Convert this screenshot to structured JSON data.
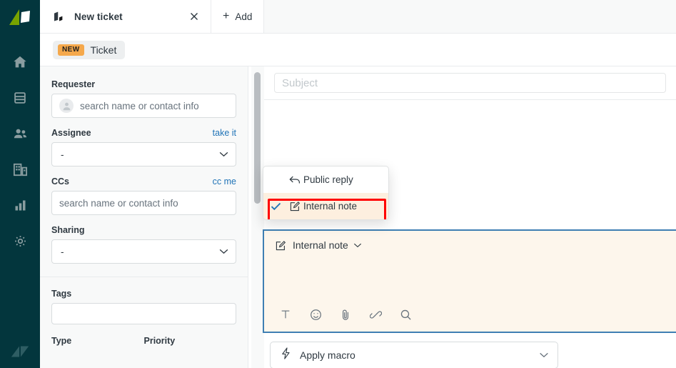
{
  "nav": {
    "logo_icon": "zendesk-logo-icon",
    "items": [
      {
        "name": "home",
        "icon": "home-icon"
      },
      {
        "name": "views",
        "icon": "views-list-icon"
      },
      {
        "name": "customers",
        "icon": "people-icon"
      },
      {
        "name": "organizations",
        "icon": "buildings-icon"
      },
      {
        "name": "reporting",
        "icon": "bar-chart-icon"
      },
      {
        "name": "admin",
        "icon": "gear-icon"
      }
    ],
    "bottom_logo_icon": "zendesk-z-icon"
  },
  "tabbar": {
    "tab_label": "New ticket",
    "tab_icon": "ticket-icon",
    "close_icon": "close-icon",
    "add_label": "Add",
    "add_plus": "+"
  },
  "ticket_header": {
    "badge": "NEW",
    "title": "Ticket"
  },
  "form": {
    "requester": {
      "label": "Requester",
      "placeholder": "search name or contact info",
      "avatar_icon": "user-avatar-icon"
    },
    "assignee": {
      "label": "Assignee",
      "action": "take it",
      "value": "-"
    },
    "ccs": {
      "label": "CCs",
      "action": "cc me",
      "placeholder": "search name or contact info"
    },
    "sharing": {
      "label": "Sharing",
      "value": "-"
    },
    "tags": {
      "label": "Tags",
      "value": ""
    },
    "type": {
      "label": "Type"
    },
    "priority": {
      "label": "Priority"
    }
  },
  "main": {
    "subject_placeholder": "Subject"
  },
  "channel_menu": {
    "items": [
      {
        "label": "Public reply",
        "icon": "reply-arrow-icon",
        "selected": false
      },
      {
        "label": "Internal note",
        "icon": "note-pencil-icon",
        "selected": true
      }
    ],
    "check_icon": "check-icon",
    "highlight_color": "#ff0000"
  },
  "composer": {
    "channel_label": "Internal note",
    "channel_icon": "note-pencil-icon",
    "chevron_icon": "chevron-down-icon",
    "background_color": "#fdf6ec",
    "border_color": "#3f7fb3",
    "tools": [
      {
        "name": "text-format",
        "icon": "text-format-icon"
      },
      {
        "name": "emoji",
        "icon": "emoji-icon"
      },
      {
        "name": "attachment",
        "icon": "paperclip-icon"
      },
      {
        "name": "link",
        "icon": "link-icon"
      },
      {
        "name": "search",
        "icon": "search-icon"
      }
    ]
  },
  "macro": {
    "label": "Apply macro",
    "icon": "lightning-bolt-icon",
    "chevron_icon": "chevron-down-icon"
  },
  "colors": {
    "nav_background": "#03363d",
    "accent_link": "#1f73b7",
    "badge_new": "#f5a84b",
    "panel_background": "#f8f9f9"
  }
}
